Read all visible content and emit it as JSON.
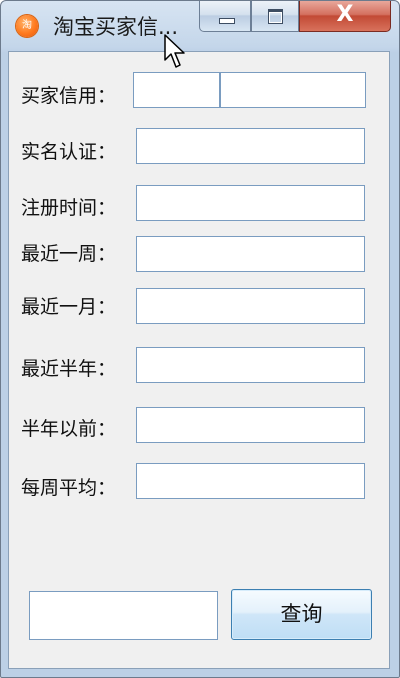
{
  "window": {
    "title": "淘宝买家信...",
    "icon": "taobao-app-icon",
    "icon_glyph": "淘",
    "close_glyph": "X"
  },
  "form": {
    "buyer_credit_label": "买家信用：",
    "buyer_credit_value_1": "",
    "buyer_credit_value_2": "",
    "real_name_label": "实名认证：",
    "real_name_value": "",
    "register_time_label": "注册时间：",
    "register_time_value": "",
    "last_week_label": "最近一周：",
    "last_week_value": "",
    "last_month_label": "最近一月：",
    "last_month_value": "",
    "last_half_year_label": "最近半年：",
    "last_half_year_value": "",
    "before_half_year_label": "半年以前：",
    "before_half_year_value": "",
    "weekly_avg_label": "每周平均：",
    "weekly_avg_value": ""
  },
  "query": {
    "input_value": "",
    "button_label": "查询"
  },
  "colors": {
    "titlebar": "#c4d6ea",
    "client_bg": "#f0f0f0",
    "field_border": "#7a9cc0",
    "close_button": "#c24a35",
    "button_border": "#3c7fb1"
  }
}
